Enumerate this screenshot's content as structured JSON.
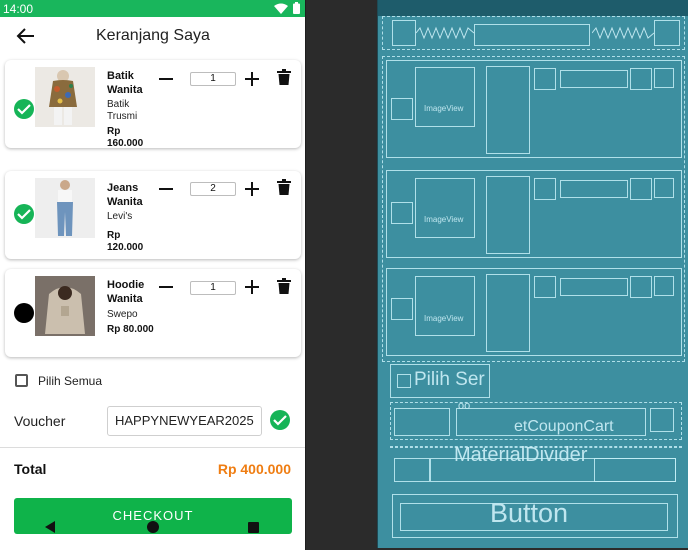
{
  "status_bar": {
    "time": "14:00"
  },
  "app_bar": {
    "title": "Keranjang Saya"
  },
  "cart_items": [
    {
      "name": "Batik Wanita",
      "brand": "Batik Trusmi",
      "price": "Rp 160.000",
      "qty": "1",
      "selected": true
    },
    {
      "name": "Jeans Wanita",
      "brand": "Levi's",
      "price": "Rp 120.000",
      "qty": "2",
      "selected": true
    },
    {
      "name": "Hoodie Wanita",
      "brand": "Swepo",
      "price": "Rp 80.000",
      "qty": "1",
      "selected": false
    }
  ],
  "select_all": {
    "label": "Pilih Semua",
    "checked": false
  },
  "voucher": {
    "label": "Voucher",
    "value": "HAPPYNEWYEAR2025"
  },
  "total": {
    "label": "Total",
    "value": "Rp 400.000"
  },
  "checkout": {
    "label": "CHECKOUT"
  },
  "blueprint": {
    "imageview_label": "ImageView",
    "pilih_label": "Pilih Ser",
    "coupon_label": "etCouponCart",
    "coupon_tail": "oo",
    "divider_label": "MaterialDivider",
    "button_label": "Button"
  },
  "colors": {
    "primary": "#16b457",
    "status_bar": "#19b65c",
    "total": "#ef7d12",
    "blueprint": "#3d8fa0"
  }
}
